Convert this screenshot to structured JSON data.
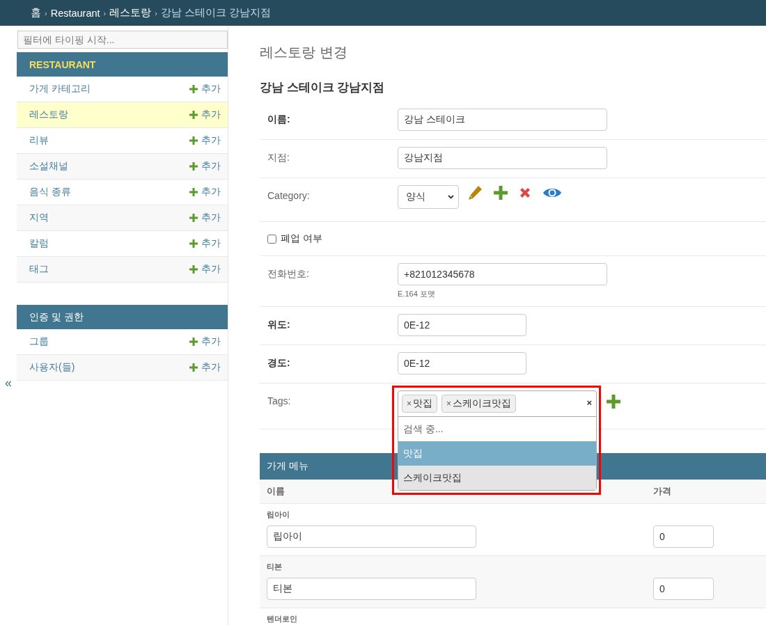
{
  "breadcrumbs": {
    "separator": "›",
    "items": [
      "홈",
      "Restaurant",
      "레스토랑",
      "강남 스테이크 강남지점"
    ]
  },
  "sidebar": {
    "filter_placeholder": "필터에 타이핑 시작...",
    "collapse_toggle": "«",
    "sections": [
      {
        "title": "RESTAURANT",
        "current": true,
        "items": [
          {
            "label": "가게 카테고리",
            "add": "추가",
            "selected": false
          },
          {
            "label": "레스토랑",
            "add": "추가",
            "selected": true
          },
          {
            "label": "리뷰",
            "add": "추가",
            "selected": false
          },
          {
            "label": "소설채널",
            "add": "추가",
            "selected": false
          },
          {
            "label": "음식 종류",
            "add": "추가",
            "selected": false
          },
          {
            "label": "지역",
            "add": "추가",
            "selected": false
          },
          {
            "label": "칼럼",
            "add": "추가",
            "selected": false
          },
          {
            "label": "태그",
            "add": "추가",
            "selected": false
          }
        ]
      },
      {
        "title": "인증 및 권한",
        "current": false,
        "items": [
          {
            "label": "그룹",
            "add": "추가",
            "selected": false
          },
          {
            "label": "사용자(들)",
            "add": "추가",
            "selected": false
          }
        ]
      }
    ]
  },
  "main": {
    "page_title": "레스토랑 변경",
    "object_title": "강남 스테이크 강남지점",
    "fields": [
      {
        "kind": "text",
        "label": "이름:",
        "required": true,
        "value": "강남 스테이크"
      },
      {
        "kind": "text",
        "label": "지점:",
        "required": false,
        "value": "강남지점"
      },
      {
        "kind": "select",
        "label": "Category:",
        "required": false,
        "value": "양식"
      },
      {
        "kind": "checkbox",
        "label": "폐업 여부",
        "checked": false
      },
      {
        "kind": "text",
        "label": "전화번호:",
        "required": false,
        "value": "+821012345678",
        "help": "E.164 포맷"
      },
      {
        "kind": "decimal",
        "label": "위도:",
        "required": true,
        "value": "0E-12"
      },
      {
        "kind": "decimal",
        "label": "경도:",
        "required": true,
        "value": "0E-12"
      },
      {
        "kind": "tags",
        "label": "Tags:",
        "required": false,
        "chips": [
          {
            "remove": "×",
            "label": "맛집"
          },
          {
            "remove": "×",
            "label": "스케이크맛집"
          }
        ],
        "clear": "×",
        "search_text": "검색 중...",
        "options": [
          {
            "label": "맛집",
            "selected": true
          },
          {
            "label": "스케이크맛집",
            "selected": false
          }
        ]
      }
    ],
    "inline": {
      "title": "가게 메뉴",
      "columns": [
        "이름",
        "가격"
      ],
      "rows": [
        {
          "label": "립아이",
          "name": "립아이",
          "price": "0"
        },
        {
          "label": "티본",
          "name": "티본",
          "price": "0"
        },
        {
          "label": "텐더로인"
        }
      ]
    }
  }
}
